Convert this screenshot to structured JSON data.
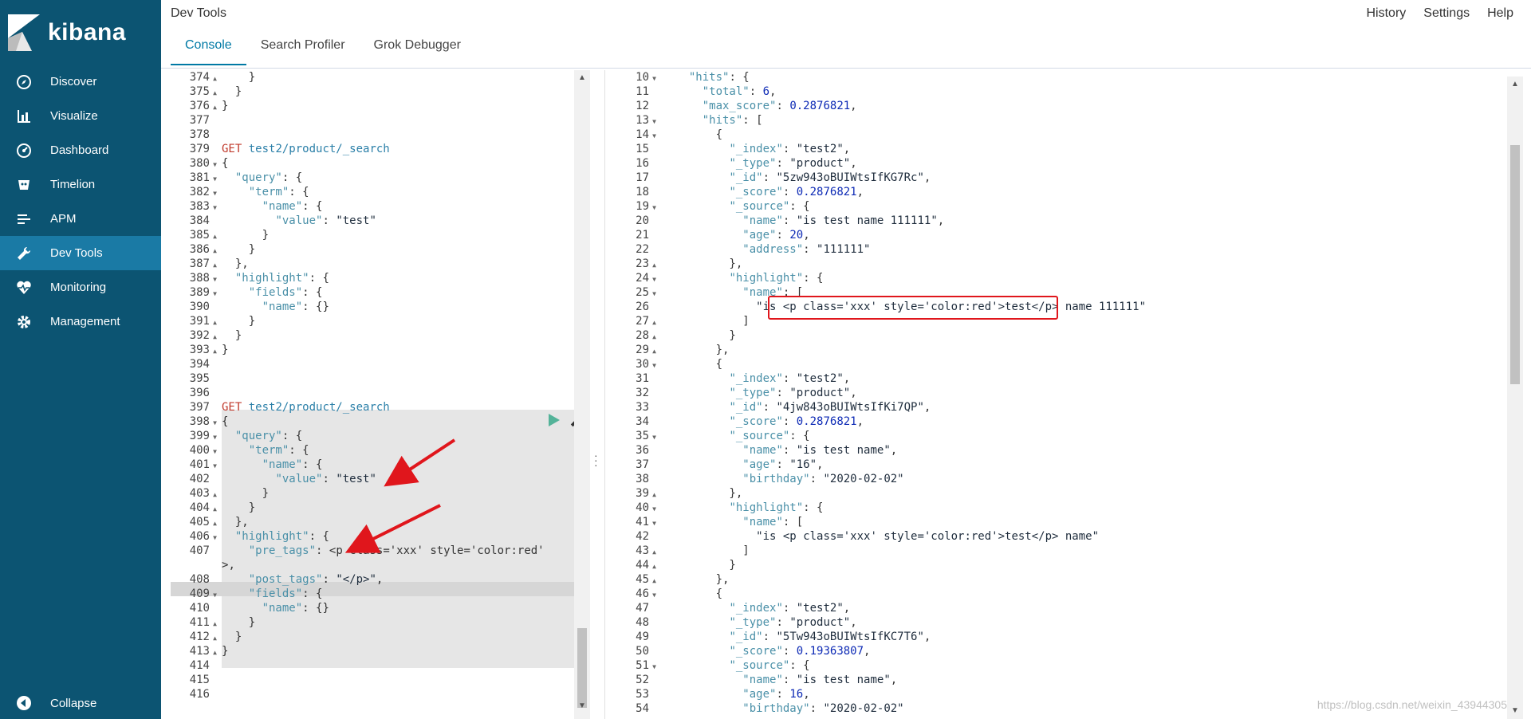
{
  "sidebar": {
    "logo": "kibana",
    "items": [
      {
        "label": "Discover",
        "icon": "compass-icon"
      },
      {
        "label": "Visualize",
        "icon": "bar-chart-icon"
      },
      {
        "label": "Dashboard",
        "icon": "dashboard-icon"
      },
      {
        "label": "Timelion",
        "icon": "timelion-icon"
      },
      {
        "label": "APM",
        "icon": "apm-icon"
      },
      {
        "label": "Dev Tools",
        "icon": "wrench-icon",
        "active": true
      },
      {
        "label": "Monitoring",
        "icon": "heartbeat-icon"
      },
      {
        "label": "Management",
        "icon": "gear-icon"
      }
    ],
    "collapse": "Collapse"
  },
  "header": {
    "title": "Dev Tools",
    "links": [
      "History",
      "Settings",
      "Help"
    ],
    "tabs": [
      "Console",
      "Search Profiler",
      "Grok Debugger"
    ]
  },
  "editor": {
    "lines": [
      {
        "n": "374",
        "f": "up",
        "t": "    }"
      },
      {
        "n": "375",
        "f": "up",
        "t": "  }"
      },
      {
        "n": "376",
        "f": "up",
        "t": "}"
      },
      {
        "n": "377",
        "f": "",
        "t": ""
      },
      {
        "n": "378",
        "f": "",
        "t": ""
      },
      {
        "n": "379",
        "f": "",
        "t": "GET test2/product/_search",
        "kind": "req"
      },
      {
        "n": "380",
        "f": "down",
        "t": "{"
      },
      {
        "n": "381",
        "f": "down",
        "t": "  \"query\": {"
      },
      {
        "n": "382",
        "f": "down",
        "t": "    \"term\": {"
      },
      {
        "n": "383",
        "f": "down",
        "t": "      \"name\": {"
      },
      {
        "n": "384",
        "f": "",
        "t": "        \"value\": \"test\""
      },
      {
        "n": "385",
        "f": "up",
        "t": "      }"
      },
      {
        "n": "386",
        "f": "up",
        "t": "    }"
      },
      {
        "n": "387",
        "f": "up",
        "t": "  },"
      },
      {
        "n": "388",
        "f": "down",
        "t": "  \"highlight\": {"
      },
      {
        "n": "389",
        "f": "down",
        "t": "    \"fields\": {"
      },
      {
        "n": "390",
        "f": "",
        "t": "      \"name\": {}"
      },
      {
        "n": "391",
        "f": "up",
        "t": "    }"
      },
      {
        "n": "392",
        "f": "up",
        "t": "  }"
      },
      {
        "n": "393",
        "f": "up",
        "t": "}"
      },
      {
        "n": "394",
        "f": "",
        "t": ""
      },
      {
        "n": "395",
        "f": "",
        "t": ""
      },
      {
        "n": "396",
        "f": "",
        "t": ""
      },
      {
        "n": "397",
        "f": "",
        "t": "GET test2/product/_search",
        "kind": "req"
      },
      {
        "n": "398",
        "f": "down",
        "t": "{"
      },
      {
        "n": "399",
        "f": "down",
        "t": "  \"query\": {"
      },
      {
        "n": "400",
        "f": "down",
        "t": "    \"term\": {"
      },
      {
        "n": "401",
        "f": "down",
        "t": "      \"name\": {"
      },
      {
        "n": "402",
        "f": "",
        "t": "        \"value\": \"test\""
      },
      {
        "n": "403",
        "f": "up",
        "t": "      }"
      },
      {
        "n": "404",
        "f": "up",
        "t": "    }"
      },
      {
        "n": "405",
        "f": "up",
        "t": "  },"
      },
      {
        "n": "406",
        "f": "down",
        "t": "  \"highlight\": {"
      },
      {
        "n": "407",
        "f": "",
        "t": "    \"pre_tags\": \"<p class='xxx' style='color:red'"
      },
      {
        "n": "",
        "f": "",
        "t": ">\","
      },
      {
        "n": "408",
        "f": "",
        "t": "    \"post_tags\": \"</p>\",",
        "current": true
      },
      {
        "n": "409",
        "f": "down",
        "t": "    \"fields\": {"
      },
      {
        "n": "410",
        "f": "",
        "t": "      \"name\": {}"
      },
      {
        "n": "411",
        "f": "up",
        "t": "    }"
      },
      {
        "n": "412",
        "f": "up",
        "t": "  }"
      },
      {
        "n": "413",
        "f": "up",
        "t": "}"
      },
      {
        "n": "414",
        "f": "",
        "t": ""
      },
      {
        "n": "415",
        "f": "",
        "t": ""
      },
      {
        "n": "416",
        "f": "",
        "t": ""
      }
    ]
  },
  "output": {
    "lines": [
      {
        "n": "10",
        "f": "down",
        "t": "  \"hits\": {"
      },
      {
        "n": "11",
        "f": "",
        "t": "    \"total\": 6,"
      },
      {
        "n": "12",
        "f": "",
        "t": "    \"max_score\": 0.2876821,"
      },
      {
        "n": "13",
        "f": "down",
        "t": "    \"hits\": ["
      },
      {
        "n": "14",
        "f": "down",
        "t": "      {"
      },
      {
        "n": "15",
        "f": "",
        "t": "        \"_index\": \"test2\","
      },
      {
        "n": "16",
        "f": "",
        "t": "        \"_type\": \"product\","
      },
      {
        "n": "17",
        "f": "",
        "t": "        \"_id\": \"5zw943oBUIWtsIfKG7Rc\","
      },
      {
        "n": "18",
        "f": "",
        "t": "        \"_score\": 0.2876821,"
      },
      {
        "n": "19",
        "f": "down",
        "t": "        \"_source\": {"
      },
      {
        "n": "20",
        "f": "",
        "t": "          \"name\": \"is test name 111111\","
      },
      {
        "n": "21",
        "f": "",
        "t": "          \"age\": 20,"
      },
      {
        "n": "22",
        "f": "",
        "t": "          \"address\": \"111111\""
      },
      {
        "n": "23",
        "f": "up",
        "t": "        },"
      },
      {
        "n": "24",
        "f": "down",
        "t": "        \"highlight\": {"
      },
      {
        "n": "25",
        "f": "down",
        "t": "          \"name\": ["
      },
      {
        "n": "26",
        "f": "",
        "t": "            \"is <p class='xxx' style='color:red'>test</p> name 111111\""
      },
      {
        "n": "27",
        "f": "up",
        "t": "          ]"
      },
      {
        "n": "28",
        "f": "up",
        "t": "        }"
      },
      {
        "n": "29",
        "f": "up",
        "t": "      },"
      },
      {
        "n": "30",
        "f": "down",
        "t": "      {"
      },
      {
        "n": "31",
        "f": "",
        "t": "        \"_index\": \"test2\","
      },
      {
        "n": "32",
        "f": "",
        "t": "        \"_type\": \"product\","
      },
      {
        "n": "33",
        "f": "",
        "t": "        \"_id\": \"4jw843oBUIWtsIfKi7QP\","
      },
      {
        "n": "34",
        "f": "",
        "t": "        \"_score\": 0.2876821,"
      },
      {
        "n": "35",
        "f": "down",
        "t": "        \"_source\": {"
      },
      {
        "n": "36",
        "f": "",
        "t": "          \"name\": \"is test name\","
      },
      {
        "n": "37",
        "f": "",
        "t": "          \"age\": \"16\","
      },
      {
        "n": "38",
        "f": "",
        "t": "          \"birthday\": \"2020-02-02\""
      },
      {
        "n": "39",
        "f": "up",
        "t": "        },"
      },
      {
        "n": "40",
        "f": "down",
        "t": "        \"highlight\": {"
      },
      {
        "n": "41",
        "f": "down",
        "t": "          \"name\": ["
      },
      {
        "n": "42",
        "f": "",
        "t": "            \"is <p class='xxx' style='color:red'>test</p> name\""
      },
      {
        "n": "43",
        "f": "up",
        "t": "          ]"
      },
      {
        "n": "44",
        "f": "up",
        "t": "        }"
      },
      {
        "n": "45",
        "f": "up",
        "t": "      },"
      },
      {
        "n": "46",
        "f": "down",
        "t": "      {"
      },
      {
        "n": "47",
        "f": "",
        "t": "        \"_index\": \"test2\","
      },
      {
        "n": "48",
        "f": "",
        "t": "        \"_type\": \"product\","
      },
      {
        "n": "49",
        "f": "",
        "t": "        \"_id\": \"5Tw943oBUIWtsIfKC7T6\","
      },
      {
        "n": "50",
        "f": "",
        "t": "        \"_score\": 0.19363807,"
      },
      {
        "n": "51",
        "f": "down",
        "t": "        \"_source\": {"
      },
      {
        "n": "52",
        "f": "",
        "t": "          \"name\": \"is test name\","
      },
      {
        "n": "53",
        "f": "",
        "t": "          \"age\": 16,"
      },
      {
        "n": "54",
        "f": "",
        "t": "          \"birthday\": \"2020-02-02\""
      }
    ]
  },
  "watermark": "https://blog.csdn.net/weixin_43944305",
  "colors": {
    "sidebar": "#0c5472",
    "active": "#1a7aa5",
    "accent": "#0079a5",
    "annotation": "#e0161c"
  }
}
